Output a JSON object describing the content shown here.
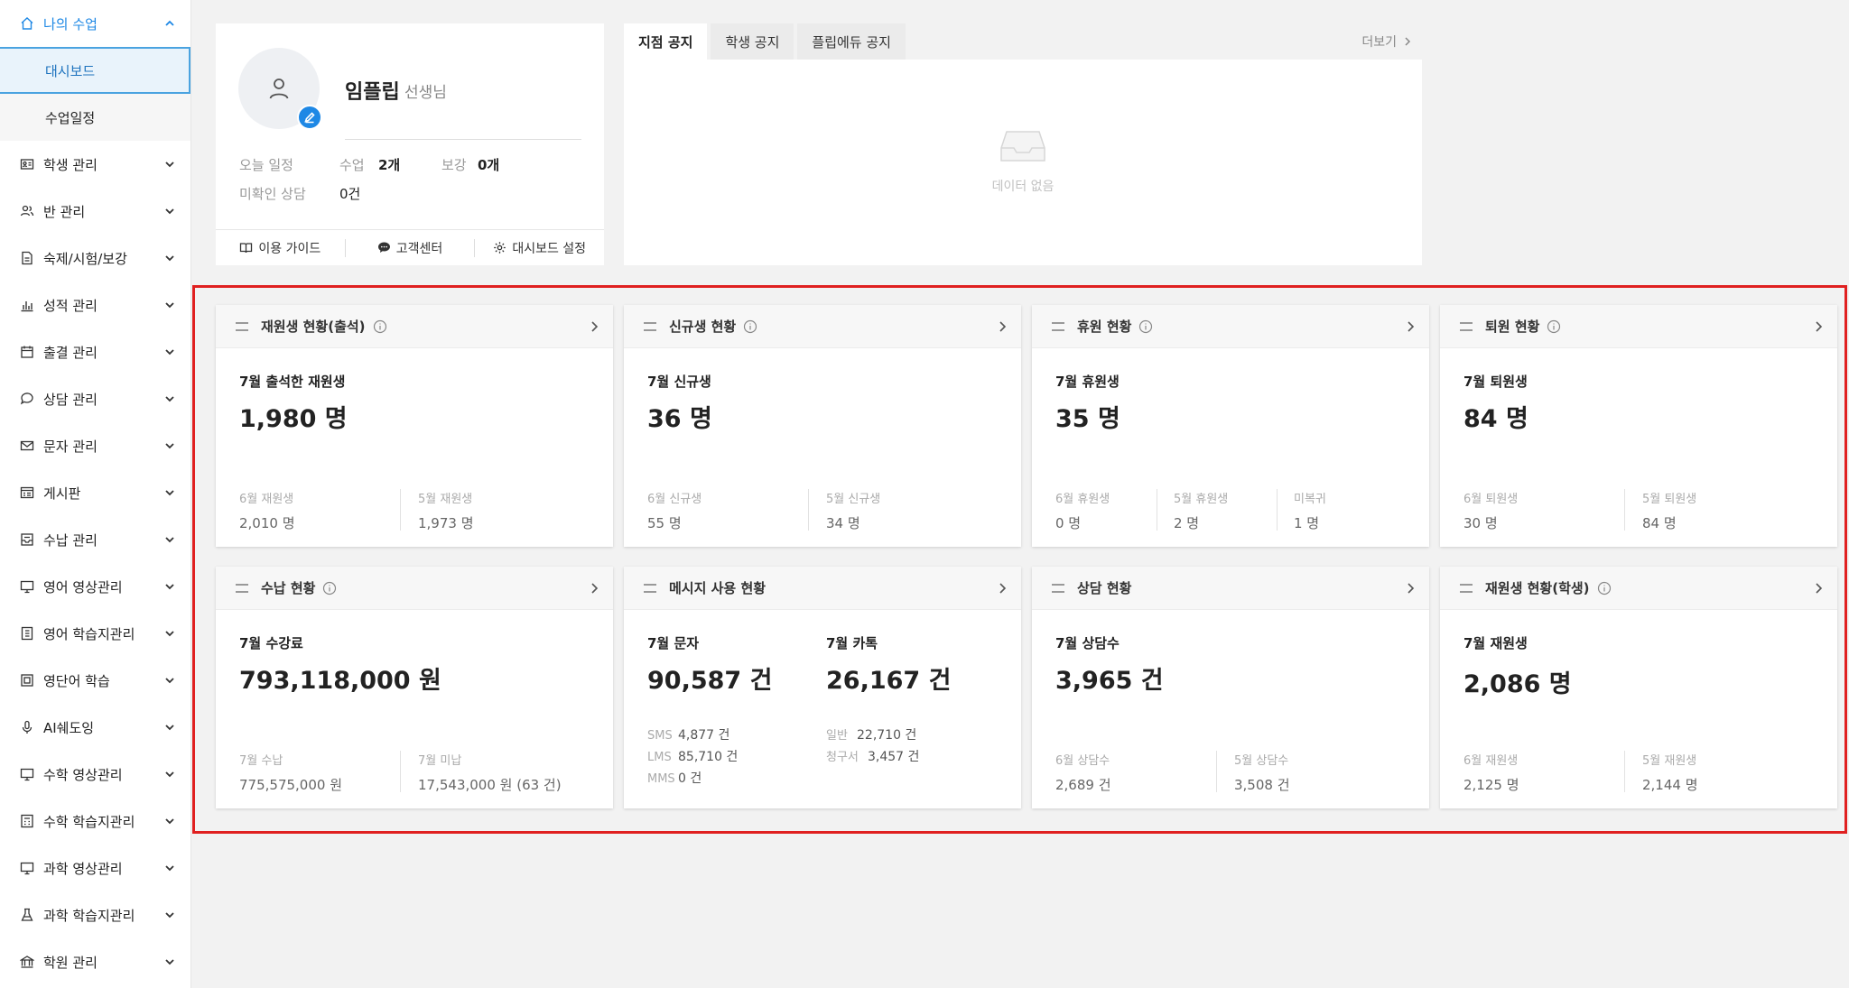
{
  "sidebar": {
    "items": [
      {
        "label": "나의 수업",
        "icon": "home-icon",
        "open": true
      },
      {
        "label": "학생 관리",
        "icon": "id-card-icon"
      },
      {
        "label": "반 관리",
        "icon": "users-icon"
      },
      {
        "label": "숙제/시험/보강",
        "icon": "document-icon"
      },
      {
        "label": "성적 관리",
        "icon": "bar-chart-icon"
      },
      {
        "label": "출결 관리",
        "icon": "calendar-icon"
      },
      {
        "label": "상담 관리",
        "icon": "chat-icon"
      },
      {
        "label": "문자 관리",
        "icon": "mail-icon"
      },
      {
        "label": "게시판",
        "icon": "board-icon"
      },
      {
        "label": "수납 관리",
        "icon": "inbox-icon"
      },
      {
        "label": "영어 영상관리",
        "icon": "monitor-icon"
      },
      {
        "label": "영어 학습지관리",
        "icon": "workbook-icon"
      },
      {
        "label": "영단어 학습",
        "icon": "vocab-icon"
      },
      {
        "label": "AI쉐도잉",
        "icon": "microphone-icon"
      },
      {
        "label": "수학 영상관리",
        "icon": "monitor-icon"
      },
      {
        "label": "수학 학습지관리",
        "icon": "calculator-icon"
      },
      {
        "label": "과학 영상관리",
        "icon": "monitor-icon"
      },
      {
        "label": "과학 학습지관리",
        "icon": "flask-icon"
      },
      {
        "label": "학원 관리",
        "icon": "building-icon"
      }
    ],
    "sub_items": [
      "대시보드",
      "수업일정"
    ]
  },
  "profile": {
    "name": "임플립",
    "role": "선생님",
    "today_label": "오늘 일정",
    "class_label": "수업",
    "class_value": "2개",
    "makeup_label": "보강",
    "makeup_value": "0개",
    "consult_label": "미확인 상담",
    "consult_value": "0건",
    "buttons": [
      "이용 가이드",
      "고객센터",
      "대시보드 설정"
    ]
  },
  "notice": {
    "tabs": [
      "지점 공지",
      "학생 공지",
      "플립에듀 공지"
    ],
    "more": "더보기",
    "empty": "데이터 없음"
  },
  "cards": [
    {
      "title": "재원생 현황(출석)",
      "info": true,
      "label": "7월 출석한 재원생",
      "value": "1,980 명",
      "subs": [
        {
          "l": "6월 재원생",
          "v": "2,010 명"
        },
        {
          "l": "5월 재원생",
          "v": "1,973 명"
        }
      ]
    },
    {
      "title": "신규생 현황",
      "info": true,
      "label": "7월 신규생",
      "value": "36 명",
      "subs": [
        {
          "l": "6월 신규생",
          "v": "55 명"
        },
        {
          "l": "5월 신규생",
          "v": "34 명"
        }
      ]
    },
    {
      "title": "휴원 현황",
      "info": true,
      "label": "7월 휴원생",
      "value": "35 명",
      "subs": [
        {
          "l": "6월 휴원생",
          "v": "0 명"
        },
        {
          "l": "5월 휴원생",
          "v": "2 명"
        },
        {
          "l": "미복귀",
          "v": "1 명"
        }
      ]
    },
    {
      "title": "퇴원 현황",
      "info": true,
      "label": "7월 퇴원생",
      "value": "84 명",
      "subs": [
        {
          "l": "6월 퇴원생",
          "v": "30 명"
        },
        {
          "l": "5월 퇴원생",
          "v": "84 명"
        }
      ]
    },
    {
      "title": "수납 현황",
      "info": true,
      "label": "7월 수강료",
      "value": "793,118,000 원",
      "subs": [
        {
          "l": "7월 수납",
          "v": "775,575,000 원"
        },
        {
          "l": "7월 미납",
          "v": "17,543,000 원 (63 건)"
        }
      ]
    },
    {
      "title": "메시지 사용 현황",
      "info": false,
      "label": "7월 문자",
      "value": "90,587 건",
      "label2": "7월 카톡",
      "value2": "26,167 건",
      "mini_left": [
        {
          "l": "SMS",
          "v": "4,877 건"
        },
        {
          "l": "LMS",
          "v": "85,710 건"
        },
        {
          "l": "MMS",
          "v": "0 건"
        }
      ],
      "mini_right": [
        {
          "l": "일반",
          "v": "22,710 건"
        },
        {
          "l": "청구서",
          "v": "3,457 건"
        }
      ]
    },
    {
      "title": "상담 현황",
      "info": false,
      "label": "7월 상담수",
      "value": "3,965 건",
      "subs": [
        {
          "l": "6월 상담수",
          "v": "2,689 건"
        },
        {
          "l": "5월 상담수",
          "v": "3,508 건"
        }
      ]
    },
    {
      "title": "재원생 현황(학생)",
      "info": true,
      "label": "7월 재원생",
      "value": "2,086 명",
      "subs": [
        {
          "l": "6월 재원생",
          "v": "2,125 명"
        },
        {
          "l": "5월 재원생",
          "v": "2,144 명"
        }
      ]
    }
  ],
  "colors": {
    "accent": "#1e88e5",
    "highlight": "#e02020"
  }
}
